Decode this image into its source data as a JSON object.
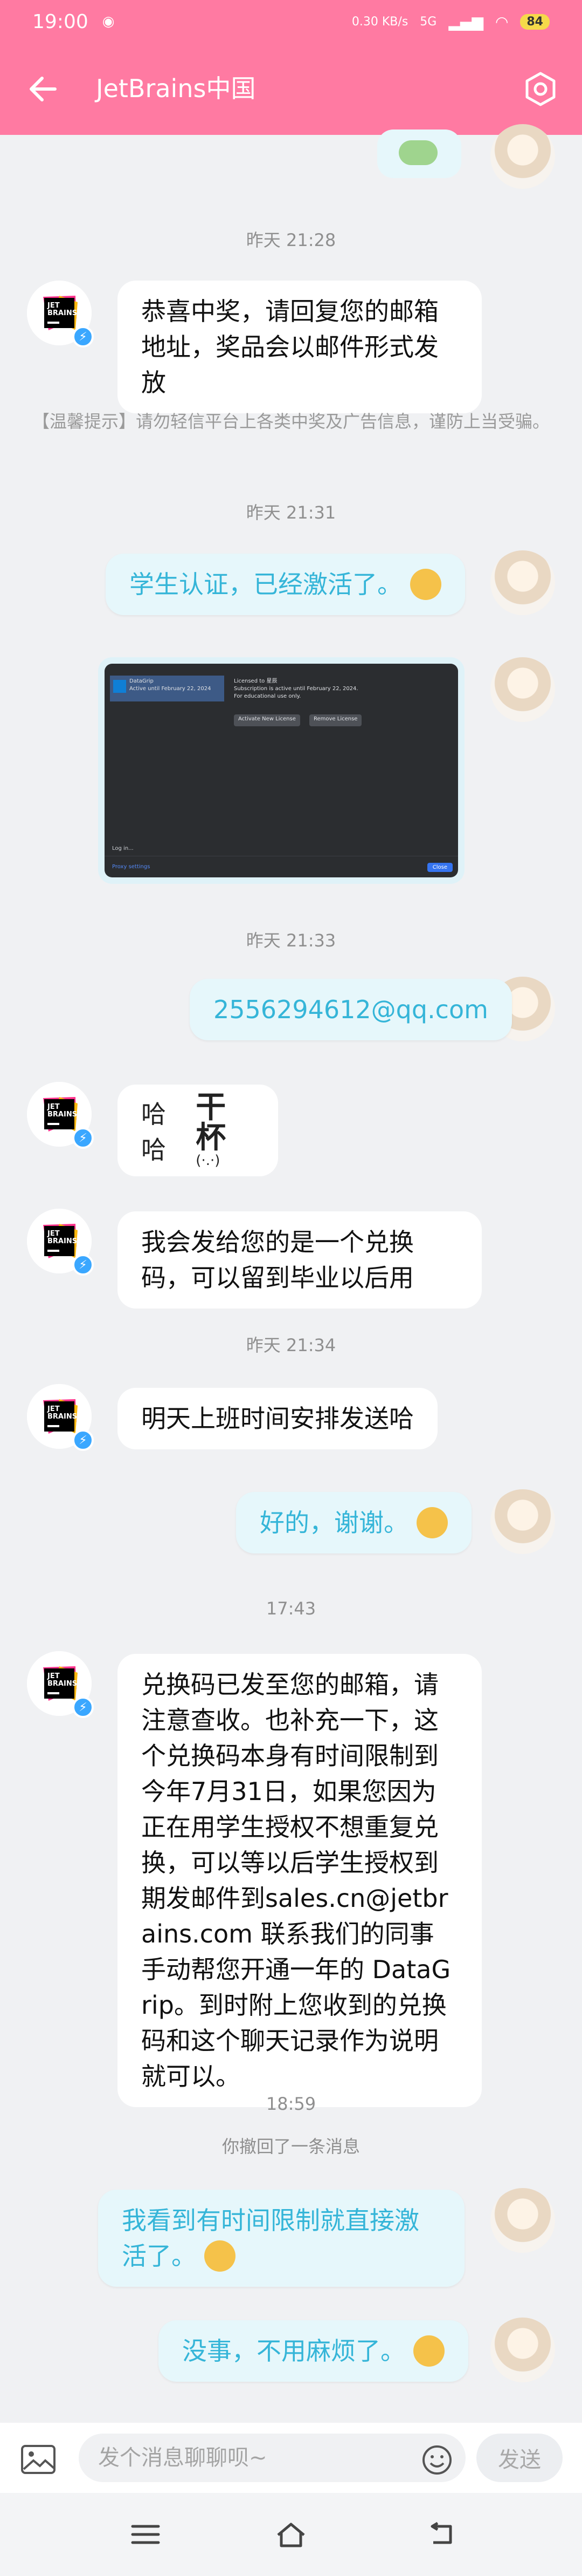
{
  "status_bar": {
    "time": "19:00",
    "network_speed": "0.30 KB/s",
    "network_type": "5G",
    "battery": "84"
  },
  "header": {
    "title": "JetBrains中国"
  },
  "messages": {
    "ts1": "昨天 21:28",
    "m1": "恭喜中奖，请回复您的邮箱地址，奖品会以邮件形式发放",
    "notice": "【温馨提示】请勿轻信平台上各类中奖及广告信息，谨防上当受骗。",
    "ts2": "昨天 21:31",
    "m2": "学生认证，已经激活了。",
    "screenshot": {
      "product": "DataGrip",
      "product_sub": "Active until February 22, 2024",
      "licensed_to": "Licensed to 星辰",
      "subscription": "Subscription is active until February 22, 2024.",
      "edu": "For educational use only.",
      "btn_activate": "Activate New License",
      "btn_remove": "Remove License",
      "login": "Log in...",
      "proxy": "Proxy settings",
      "close": "Close"
    },
    "ts3": "昨天 21:33",
    "m3": "2556294612@qq.com",
    "m4": "哈哈",
    "m4_cup": "干杯",
    "m5": "我会发给您的是一个兑换码，可以留到毕业以后用",
    "ts4": "昨天 21:34",
    "m6": "明天上班时间安排发送哈",
    "m7": "好的，谢谢。",
    "ts5": "17:43",
    "m8": "兑换码已发至您的邮箱，请注意查收。也补充一下，这个兑换码本身有时间限制到今年7月31日，如果您因为正在用学生授权不想重复兑换，可以等以后学生授权到期发邮件到sales.cn@jetbrains.com 联系我们的同事手动帮您开通一年的 DataGrip。到时附上您收到的兑换码和这个聊天记录作为说明就可以。",
    "ts6": "18:59",
    "recall": "你撤回了一条消息",
    "m9": "我看到有时间限制就直接激活了。",
    "m10": "没事，不用麻烦了。"
  },
  "input": {
    "placeholder": "发个消息聊聊呗~",
    "send_label": "发送"
  },
  "avatar_logo": "JET BRAINS",
  "colors": {
    "brand": "#ff7aa2",
    "bubble_right_text": "#35b5d8",
    "bubble_right_bg": "#e6f7fb"
  }
}
